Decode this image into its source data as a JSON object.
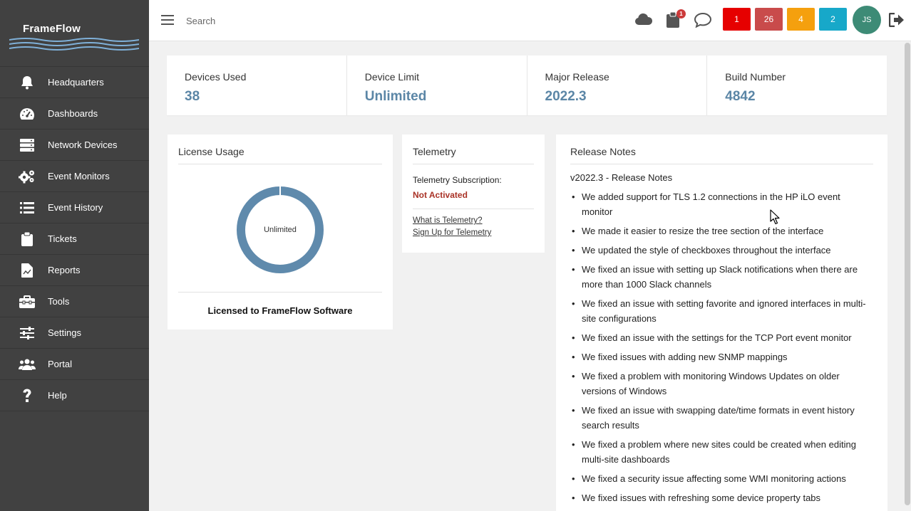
{
  "app": {
    "name": "FrameFlow"
  },
  "sidebar": {
    "items": [
      {
        "label": "Headquarters",
        "icon": "bell-icon"
      },
      {
        "label": "Dashboards",
        "icon": "gauge-icon"
      },
      {
        "label": "Network Devices",
        "icon": "server-icon"
      },
      {
        "label": "Event Monitors",
        "icon": "gears-icon"
      },
      {
        "label": "Event History",
        "icon": "list-icon"
      },
      {
        "label": "Tickets",
        "icon": "clipboard-icon"
      },
      {
        "label": "Reports",
        "icon": "report-icon"
      },
      {
        "label": "Tools",
        "icon": "toolbox-icon"
      },
      {
        "label": "Settings",
        "icon": "sliders-icon"
      },
      {
        "label": "Portal",
        "icon": "users-icon"
      },
      {
        "label": "Help",
        "icon": "question-icon"
      }
    ]
  },
  "topbar": {
    "search_placeholder": "Search",
    "ticket_badge": "1",
    "status_counts": [
      {
        "value": "1",
        "color": "#e60000"
      },
      {
        "value": "26",
        "color": "#c94b4b"
      },
      {
        "value": "4",
        "color": "#f5a00e"
      },
      {
        "value": "2",
        "color": "#17a8c9"
      }
    ],
    "avatar_initials": "JS"
  },
  "stats": [
    {
      "label": "Devices Used",
      "value": "38"
    },
    {
      "label": "Device Limit",
      "value": "Unlimited"
    },
    {
      "label": "Major Release",
      "value": "2022.3"
    },
    {
      "label": "Build Number",
      "value": "4842"
    }
  ],
  "license": {
    "title": "License Usage",
    "donut_label": "Unlimited",
    "licensed_to": "Licensed to FrameFlow Software",
    "donut_color": "#5f8aac"
  },
  "telemetry": {
    "title": "Telemetry",
    "subscription_label": "Telemetry Subscription:",
    "status": "Not Activated",
    "link_what": "What is Telemetry?",
    "link_signup": "Sign Up for Telemetry"
  },
  "release_notes": {
    "title": "Release Notes",
    "heading": "v2022.3 - Release Notes",
    "items": [
      "We added support for TLS 1.2 connections in the HP iLO event monitor",
      "We made it easier to resize the tree section of the interface",
      "We updated the style of checkboxes throughout the interface",
      "We fixed an issue with setting up Slack notifications when there are more than 1000 Slack channels",
      "We fixed an issue with setting favorite and ignored interfaces in multi-site configurations",
      "We fixed an issue with the settings for the TCP Port event monitor",
      "We fixed issues with adding new SNMP mappings",
      "We fixed a problem with monitoring Windows Updates on older versions of Windows",
      "We fixed an issue with swapping date/time formats in event history search results",
      "We fixed a problem where new sites could be created when editing multi-site dashboards",
      "We fixed a security issue affecting some WMI monitoring actions",
      "We fixed issues with refreshing some device property tabs"
    ]
  }
}
